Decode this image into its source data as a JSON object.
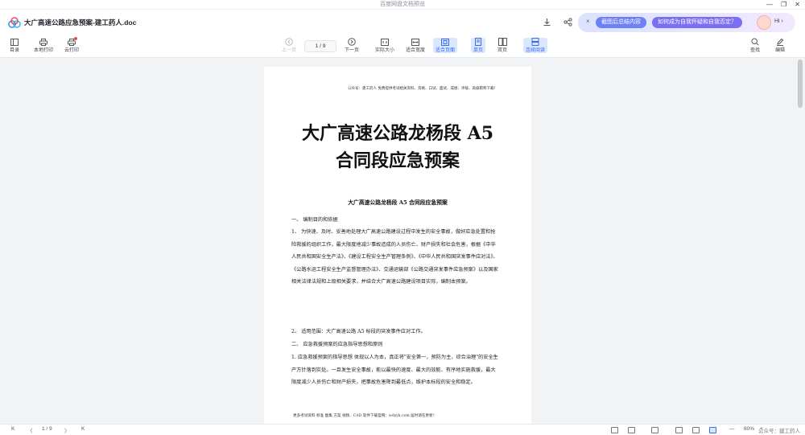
{
  "window": {
    "app_title": "百度网盘文档预览",
    "controls": [
      "—",
      "❐",
      "✕"
    ]
  },
  "titlebar": {
    "doc_title": "大广高速公路应急预案-建工药人.doc",
    "ai": {
      "close": "×",
      "pill1": "截图后总结内容",
      "pill2": "如何成为自我怀疑和自我否定？",
      "hi": "Hi ›"
    }
  },
  "toolbar": {
    "catalog": "目录",
    "local_print": "本地打印",
    "cloud_print": "云打印",
    "prev_page": "上一页",
    "page_indicator": "1 / 9",
    "next_page": "下一页",
    "actual_size": "实际大小",
    "fit_width": "适合宽度",
    "fit_page": "适合页面",
    "single_page": "单页",
    "double_page": "双页",
    "continuous": "连续阅读",
    "search": "查找",
    "edit": "编辑"
  },
  "document": {
    "header_line": "公众号：建工药人 免费提供考试相关资料、资格、口试、面试、成绩、评级、高级职称下载！",
    "title_line1": "大广高速公路龙杨段 A5",
    "title_line2": "合同段应急预案",
    "subtitle": "大广高速公路龙杨段 A5 合同段应急预案",
    "section1": "一、    编制目的和依据",
    "item1": "1、  为快速、及时、妥善地处理大广高速公路建设过程中发生的安全事故，做好应急处置和抢险救援的组织工作，最大限度地减少事故造成的人员伤亡、财产损失和社会危害，根据《中华人民共和国安全生产法》、《建设工程安全生产管理条例》、《中华人民共和国突发事件应对法》、《公路水运工程安全生产监督管理办法》、交通运输部《公路交通突发事件应急预案》以及国家相关法律法规和上级相关要求，并结合大广高速公路建设项目实际，编制本预案。",
    "item2": "2、  适用范围：大广高速公路 A5 标段的突发事件应对工作。",
    "section2": "二、    应急救援预案的应急指导思想和原则",
    "item3": "1. 应急救援预案的指导思想 体现以人为本，真正将\"安全第一，预防为主，综合治理\"的安全生产方针落到实处。一旦发生安全事故，能以最快的速度、最大的效能、有序地实施救援，最大限度减少人员伤亡和财产损失，把事故危害降到最低点，维护本标段的安全和稳定。",
    "footer": "更多考试资料 标准 图集 方案 视频、CAD 软件下载官网：wdzyk.com 届时请在更新！"
  },
  "statusbar": {
    "first": "K",
    "prev": "〈",
    "page": "1 / 9",
    "next": "〉",
    "last": "K",
    "zoom_minus": "—",
    "zoom": "80%",
    "zoom_plus": "+",
    "watermark": "公众号：建工药人"
  },
  "colors": {
    "accent": "#3a6bf0",
    "active_bg": "#dbe7ff",
    "page_bg": "#f2f3f5"
  }
}
